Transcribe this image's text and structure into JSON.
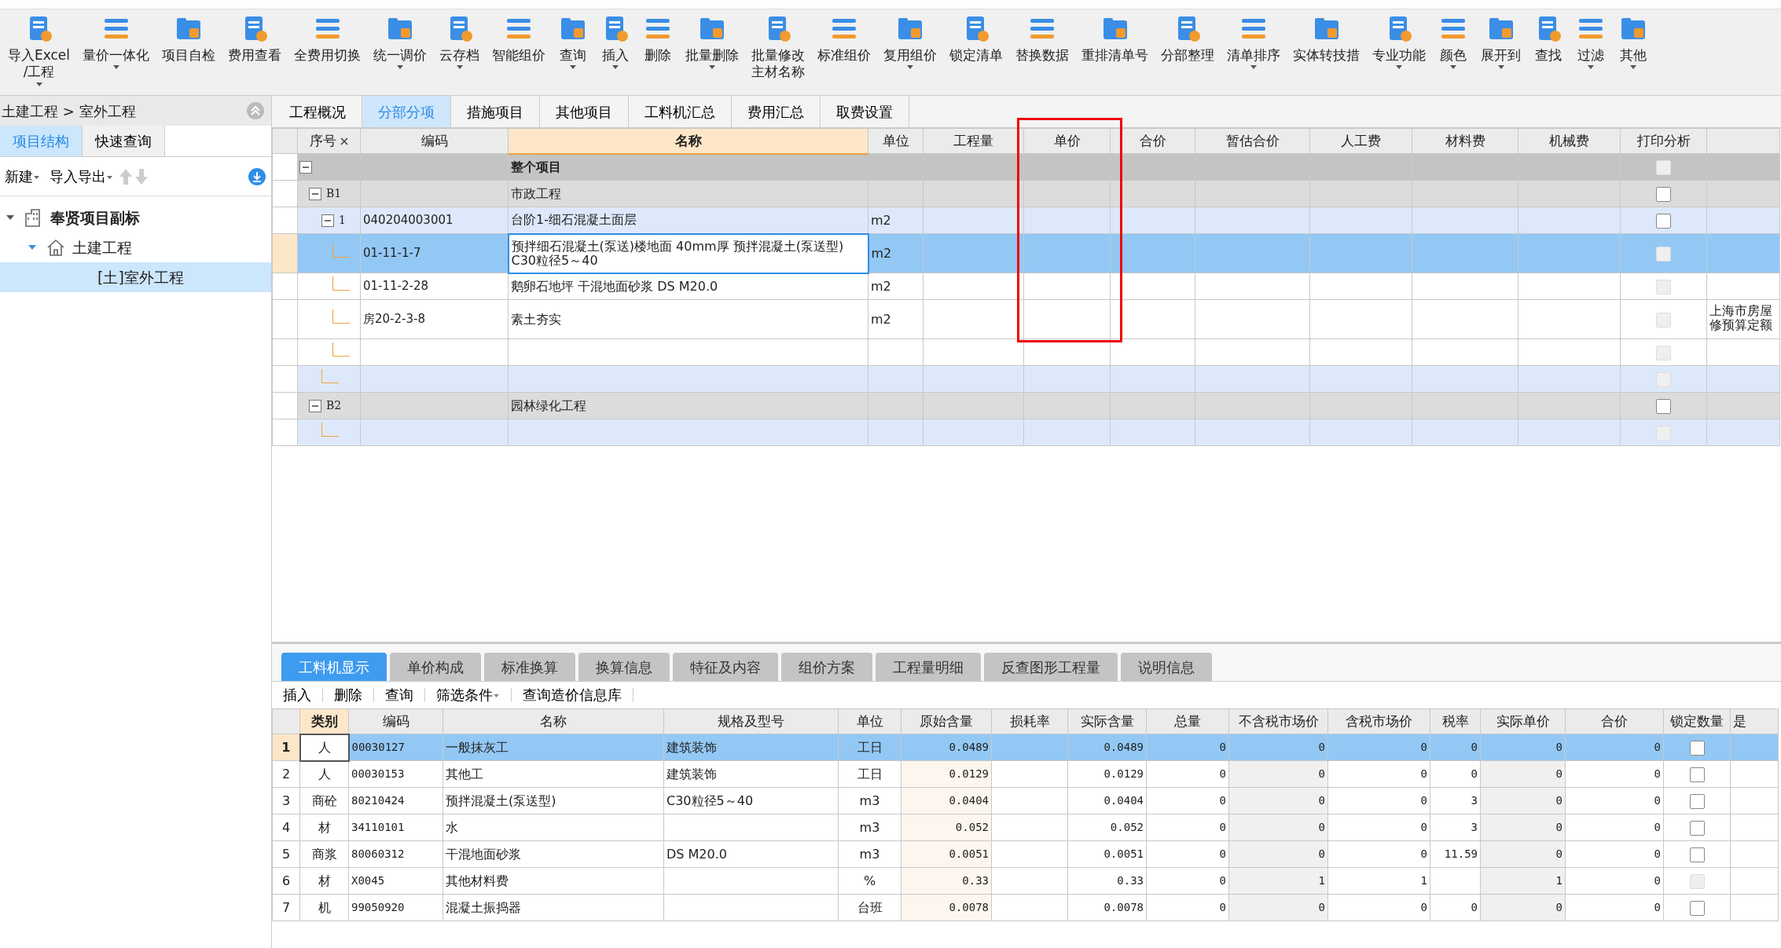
{
  "toolbar": [
    {
      "label": [
        "导入Excel",
        "/工程"
      ],
      "dropdown": true
    },
    {
      "label": [
        "量价一体化"
      ],
      "dropdown": true
    },
    {
      "label": [
        "项目自检"
      ],
      "dropdown": false
    },
    {
      "label": [
        "费用查看"
      ],
      "dropdown": false
    },
    {
      "label": [
        "全费用切换"
      ],
      "dropdown": false
    },
    {
      "label": [
        "统一调价"
      ],
      "dropdown": true
    },
    {
      "label": [
        "云存档"
      ],
      "dropdown": true
    },
    {
      "label": [
        "智能组价"
      ],
      "dropdown": false
    },
    {
      "label": [
        "查询"
      ],
      "dropdown": true
    },
    {
      "label": [
        "插入"
      ],
      "dropdown": true
    },
    {
      "label": [
        "删除"
      ],
      "dropdown": false
    },
    {
      "label": [
        "批量删除"
      ],
      "dropdown": true
    },
    {
      "label": [
        "批量修改",
        "主材名称"
      ],
      "dropdown": false
    },
    {
      "label": [
        "标准组价"
      ],
      "dropdown": false
    },
    {
      "label": [
        "复用组价"
      ],
      "dropdown": true
    },
    {
      "label": [
        "锁定清单"
      ],
      "dropdown": false
    },
    {
      "label": [
        "替换数据"
      ],
      "dropdown": false
    },
    {
      "label": [
        "重排清单号"
      ],
      "dropdown": false
    },
    {
      "label": [
        "分部整理"
      ],
      "dropdown": false
    },
    {
      "label": [
        "清单排序"
      ],
      "dropdown": true
    },
    {
      "label": [
        "实体转技措"
      ],
      "dropdown": false
    },
    {
      "label": [
        "专业功能"
      ],
      "dropdown": true
    },
    {
      "label": [
        "颜色"
      ],
      "dropdown": true
    },
    {
      "label": [
        "展开到"
      ],
      "dropdown": true
    },
    {
      "label": [
        "查找"
      ],
      "dropdown": false
    },
    {
      "label": [
        "过滤"
      ],
      "dropdown": true
    },
    {
      "label": [
        "其他"
      ],
      "dropdown": true
    }
  ],
  "sidebar": {
    "breadcrumb": "土建工程 > 室外工程",
    "tabs": [
      {
        "label": "项目结构",
        "selected": true
      },
      {
        "label": "快速查询",
        "selected": false
      }
    ],
    "actions": [
      {
        "label": "新建",
        "dropdown": true
      },
      {
        "label": "导入导出",
        "dropdown": true
      }
    ],
    "tree": [
      {
        "label": "奉贤项目副标",
        "kind": "project",
        "expanded": true,
        "selected": false,
        "children": [
          {
            "label": "土建工程",
            "kind": "unit",
            "expanded": true,
            "selected": false,
            "children": [
              {
                "label": "[土]室外工程",
                "selected": true
              }
            ]
          }
        ]
      }
    ]
  },
  "main_tabs": [
    {
      "label": "工程概况",
      "selected": false
    },
    {
      "label": "分部分项",
      "selected": true
    },
    {
      "label": "措施项目",
      "selected": false
    },
    {
      "label": "其他项目",
      "selected": false
    },
    {
      "label": "工料机汇总",
      "selected": false
    },
    {
      "label": "费用汇总",
      "selected": false
    },
    {
      "label": "取费设置",
      "selected": false
    }
  ],
  "items_table": {
    "columns": [
      "序号",
      "编码",
      "名称",
      "单位",
      "工程量",
      "单价",
      "合价",
      "暂估合价",
      "人工费",
      "材料费",
      "机械费",
      "打印分析"
    ],
    "rows": [
      {
        "kind": "root",
        "seq": "",
        "code": "",
        "name": "整个项目",
        "unit": "",
        "expanded": true,
        "disabled": true,
        "selected": false
      },
      {
        "kind": "section",
        "seq": "B1",
        "code": "",
        "name": "市政工程",
        "unit": "",
        "expanded": true,
        "disabled": false,
        "selected": false
      },
      {
        "kind": "item",
        "seq": "1",
        "code": "040204003001",
        "name": "台阶1-细石混凝土面层",
        "unit": "m2",
        "expanded": true,
        "disabled": false,
        "selected": false
      },
      {
        "kind": "quota",
        "seq": "",
        "code": "01-11-1-7",
        "name": "预拌细石混凝土(泵送)楼地面 40mm厚 预拌混凝土(泵送型) C30粒径5～40",
        "unit": "m2",
        "disabled": true,
        "selected": true
      },
      {
        "kind": "quota",
        "seq": "",
        "code": "01-11-2-28",
        "name": "鹅卵石地坪 干混地面砂浆 DS M20.0",
        "unit": "m2",
        "disabled": true,
        "selected": false
      },
      {
        "kind": "quota",
        "seq": "",
        "code": "房20-2-3-8",
        "name": "素土夯实",
        "unit": "m2",
        "disabled": true,
        "selected": false,
        "column_13": "上海市房屋修预算定额"
      },
      {
        "kind": "quota",
        "seq": "",
        "code": "",
        "name": "",
        "unit": "",
        "disabled": true,
        "selected": false
      },
      {
        "kind": "item",
        "seq": "",
        "code": "",
        "name": "",
        "unit": "",
        "disabled": true,
        "selected": false
      },
      {
        "kind": "section",
        "seq": "B2",
        "code": "",
        "name": "园林绿化工程",
        "unit": "",
        "expanded": true,
        "disabled": false,
        "selected": false
      },
      {
        "kind": "item",
        "seq": "",
        "code": "",
        "name": "",
        "unit": "",
        "disabled": true,
        "selected": false
      }
    ]
  },
  "detail_tabs": [
    {
      "label": "工料机显示",
      "selected": true
    },
    {
      "label": "单价构成",
      "selected": false
    },
    {
      "label": "标准换算",
      "selected": false
    },
    {
      "label": "换算信息",
      "selected": false
    },
    {
      "label": "特征及内容",
      "selected": false
    },
    {
      "label": "组价方案",
      "selected": false
    },
    {
      "label": "工程量明细",
      "selected": false
    },
    {
      "label": "反查图形工程量",
      "selected": false
    },
    {
      "label": "说明信息",
      "selected": false
    }
  ],
  "detail_actions": [
    {
      "label": "插入",
      "dropdown": false
    },
    {
      "label": "删除",
      "dropdown": false
    },
    {
      "label": "查询",
      "dropdown": false
    },
    {
      "label": "筛选条件",
      "dropdown": true
    },
    {
      "label": "查询造价信息库",
      "dropdown": false
    }
  ],
  "resources_table": {
    "columns": [
      "类别",
      "编码",
      "名称",
      "规格及型号",
      "单位",
      "原始含量",
      "损耗率",
      "实际含量",
      "总量",
      "不含税市场价",
      "含税市场价",
      "税率",
      "实际单价",
      "合价",
      "锁定数量",
      "是"
    ],
    "rows": [
      {
        "num": "1",
        "cells": [
          "人",
          "00030127",
          "一般抹灰工",
          "建筑装饰",
          "工日",
          "0.0489",
          "",
          "0.0489",
          "0",
          "0",
          "0",
          "0",
          "0",
          "0"
        ],
        "disabled": false,
        "selected": true
      },
      {
        "num": "2",
        "cells": [
          "人",
          "00030153",
          "其他工",
          "建筑装饰",
          "工日",
          "0.0129",
          "",
          "0.0129",
          "0",
          "0",
          "0",
          "0",
          "0",
          "0"
        ],
        "disabled": false,
        "selected": false
      },
      {
        "num": "3",
        "cells": [
          "商砼",
          "80210424",
          "预拌混凝土(泵送型)",
          "C30粒径5～40",
          "m3",
          "0.0404",
          "",
          "0.0404",
          "0",
          "0",
          "0",
          "3",
          "0",
          "0"
        ],
        "disabled": false,
        "selected": false
      },
      {
        "num": "4",
        "cells": [
          "材",
          "34110101",
          "水",
          "",
          "m3",
          "0.052",
          "",
          "0.052",
          "0",
          "0",
          "0",
          "3",
          "0",
          "0"
        ],
        "disabled": false,
        "selected": false
      },
      {
        "num": "5",
        "cells": [
          "商浆",
          "80060312",
          "干混地面砂浆",
          "DS M20.0",
          "m3",
          "0.0051",
          "",
          "0.0051",
          "0",
          "0",
          "0",
          "11.59",
          "0",
          "0"
        ],
        "disabled": false,
        "selected": false
      },
      {
        "num": "6",
        "cells": [
          "材",
          "X0045",
          "其他材料费",
          "",
          "%",
          "0.33",
          "",
          "0.33",
          "0",
          "1",
          "1",
          "",
          "1",
          "0"
        ],
        "disabled": true,
        "selected": false
      },
      {
        "num": "7",
        "cells": [
          "机",
          "99050920",
          "混凝土振捣器",
          "",
          "台班",
          "0.0078",
          "",
          "0.0078",
          "0",
          "0",
          "0",
          "0",
          "0",
          "0"
        ],
        "disabled": false,
        "selected": false
      }
    ]
  }
}
